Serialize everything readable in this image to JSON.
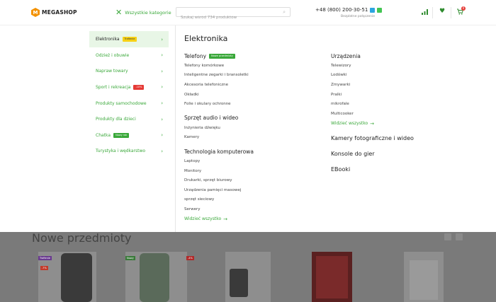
{
  "header": {
    "logo_mark": "M",
    "logo_text": "MEGASHOP",
    "all_categories": "Wszystkie kategorie",
    "search_placeholder": "Szukaj wśród 734 produktów",
    "phone": "+48 (800) 200-30-51",
    "phone_sub": "Bezpłatne połączenie",
    "cart_count": "0"
  },
  "sidebar": {
    "items": [
      {
        "label": "Elektronika",
        "badge": "Trafienie"
      },
      {
        "label": "Odzież i obuwie"
      },
      {
        "label": "Napraw towary"
      },
      {
        "label": "Sport i rekreacja",
        "badge": "-10%"
      },
      {
        "label": "Produkty samochodowe"
      },
      {
        "label": "Produkty dla dzieci"
      },
      {
        "label": "Chatka",
        "badge": "Nowy rok"
      },
      {
        "label": "Turystyka i wędkarstwo"
      }
    ]
  },
  "main": {
    "title": "Elektronika",
    "phones": {
      "title": "Telefony",
      "badge": "Nowe przedmioty",
      "links": [
        "Telefony komórkowe",
        "Inteligentne zegarki i bransoletki",
        "Akcesoria telefoniczne",
        "Okładki",
        "Folie i okulary ochronne"
      ]
    },
    "audio": {
      "title": "Sprzęt audio i wideo",
      "links": [
        "Inżynieria dźwięku",
        "Kamery"
      ]
    },
    "computers": {
      "title": "Technologia komputerowa",
      "links": [
        "Laptopy",
        "Monitory",
        "Drukarki, sprzęt biurowy",
        "Urządzenia pamięci masowej",
        "sprzęt sieciowy",
        "Serwery"
      ],
      "see_all": "Widzieć wszystko"
    },
    "devices": {
      "title": "Urządzenia",
      "links": [
        "Telewizory",
        "Lodówki",
        "Zmywarki",
        "Pralki",
        "mikrofale",
        "Multicooker"
      ],
      "see_all": "Widzieć wszystko"
    },
    "cameras_title": "Kamery fotograficzne i wideo",
    "consoles_title": "Konsole do gier",
    "ebooks_title": "EBooki"
  },
  "bottom": {
    "title": "Nowe przedmioty",
    "tags": [
      "Trafienie",
      "-7%",
      "Nowy",
      "-4%"
    ]
  },
  "colors": {
    "accent": "#3aa83a",
    "logo": "#f39200",
    "badge_red": "#e53935",
    "badge_yellow": "#f7d116"
  }
}
